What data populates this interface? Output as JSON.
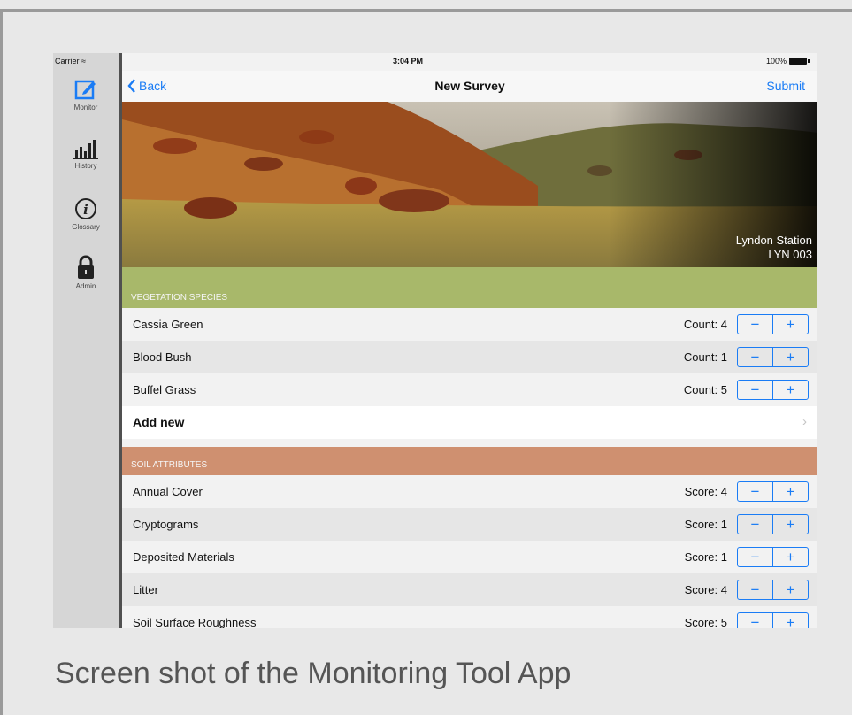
{
  "status_bar": {
    "carrier": "Carrier",
    "time": "3:04 PM",
    "battery": "100%"
  },
  "sidebar": {
    "items": [
      {
        "label": "Monitor",
        "icon": "edit-icon"
      },
      {
        "label": "History",
        "icon": "bar-chart-icon"
      },
      {
        "label": "Glossary",
        "icon": "info-icon"
      },
      {
        "label": "Admin",
        "icon": "lock-icon"
      }
    ]
  },
  "navbar": {
    "back": "Back",
    "title": "New Survey",
    "submit": "Submit"
  },
  "hero": {
    "station": "Lyndon Station",
    "code": "LYN 003"
  },
  "vegetation": {
    "header": "VEGETATION SPECIES",
    "color": "#a8b86a",
    "rows": [
      {
        "label": "Cassia Green",
        "value": "Count: 4"
      },
      {
        "label": "Blood Bush",
        "value": "Count: 1"
      },
      {
        "label": "Buffel Grass",
        "value": "Count: 5"
      }
    ],
    "add_new": "Add new"
  },
  "soil": {
    "header": "SOIL ATTRIBUTES",
    "color": "#cf9070",
    "rows": [
      {
        "label": "Annual Cover",
        "value": "Score: 4"
      },
      {
        "label": "Cryptograms",
        "value": "Score: 1"
      },
      {
        "label": "Deposited Materials",
        "value": "Score: 1"
      },
      {
        "label": "Litter",
        "value": "Score: 4"
      },
      {
        "label": "Soil Surface Roughness",
        "value": "Score: 5"
      }
    ]
  },
  "stepper": {
    "minus": "−",
    "plus": "+"
  },
  "caption": "Screen shot of the Monitoring Tool App"
}
